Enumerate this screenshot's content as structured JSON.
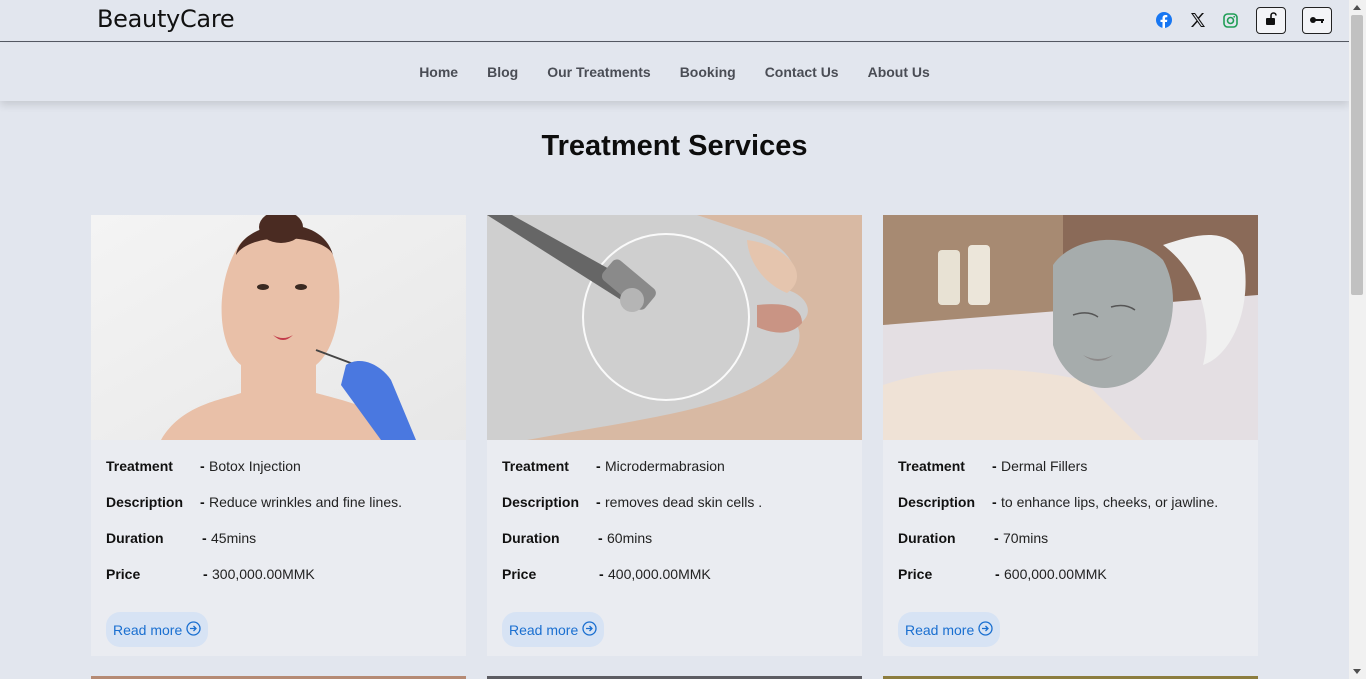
{
  "brand": {
    "name": "BeautyCare"
  },
  "header": {
    "social": [
      {
        "icon": "facebook-icon",
        "color": "#1877f2"
      },
      {
        "icon": "x-icon",
        "color": "#111111"
      },
      {
        "icon": "instagram-icon",
        "color": "#1f9d55"
      }
    ],
    "actions": [
      {
        "icon": "lock-icon"
      },
      {
        "icon": "key-icon"
      }
    ]
  },
  "nav": {
    "items": [
      "Home",
      "Blog",
      "Our Treatments",
      "Booking",
      "Contact Us",
      "About Us"
    ]
  },
  "main": {
    "title": "Treatment Services",
    "labels": {
      "treatment": "Treatment",
      "description": "Description",
      "duration": "Duration",
      "price": "Price",
      "sep": "-"
    },
    "read_more": "Read more",
    "cards": [
      {
        "treatment": "Botox Injection",
        "description": "Reduce wrinkles and fine lines.",
        "duration": "45mins",
        "price": "300,000.00MMK"
      },
      {
        "treatment": "Microdermabrasion",
        "description": "removes dead skin cells .",
        "duration": "60mins",
        "price": "400,000.00MMK"
      },
      {
        "treatment": "Dermal Fillers",
        "description": "to enhance lips, cheeks, or jawline.",
        "duration": "70mins",
        "price": "600,000.00MMK"
      }
    ]
  },
  "colors": {
    "accent": "#1a6fd0",
    "page_bg": "#e2e6ee",
    "card_bg": "#eaecf1"
  }
}
